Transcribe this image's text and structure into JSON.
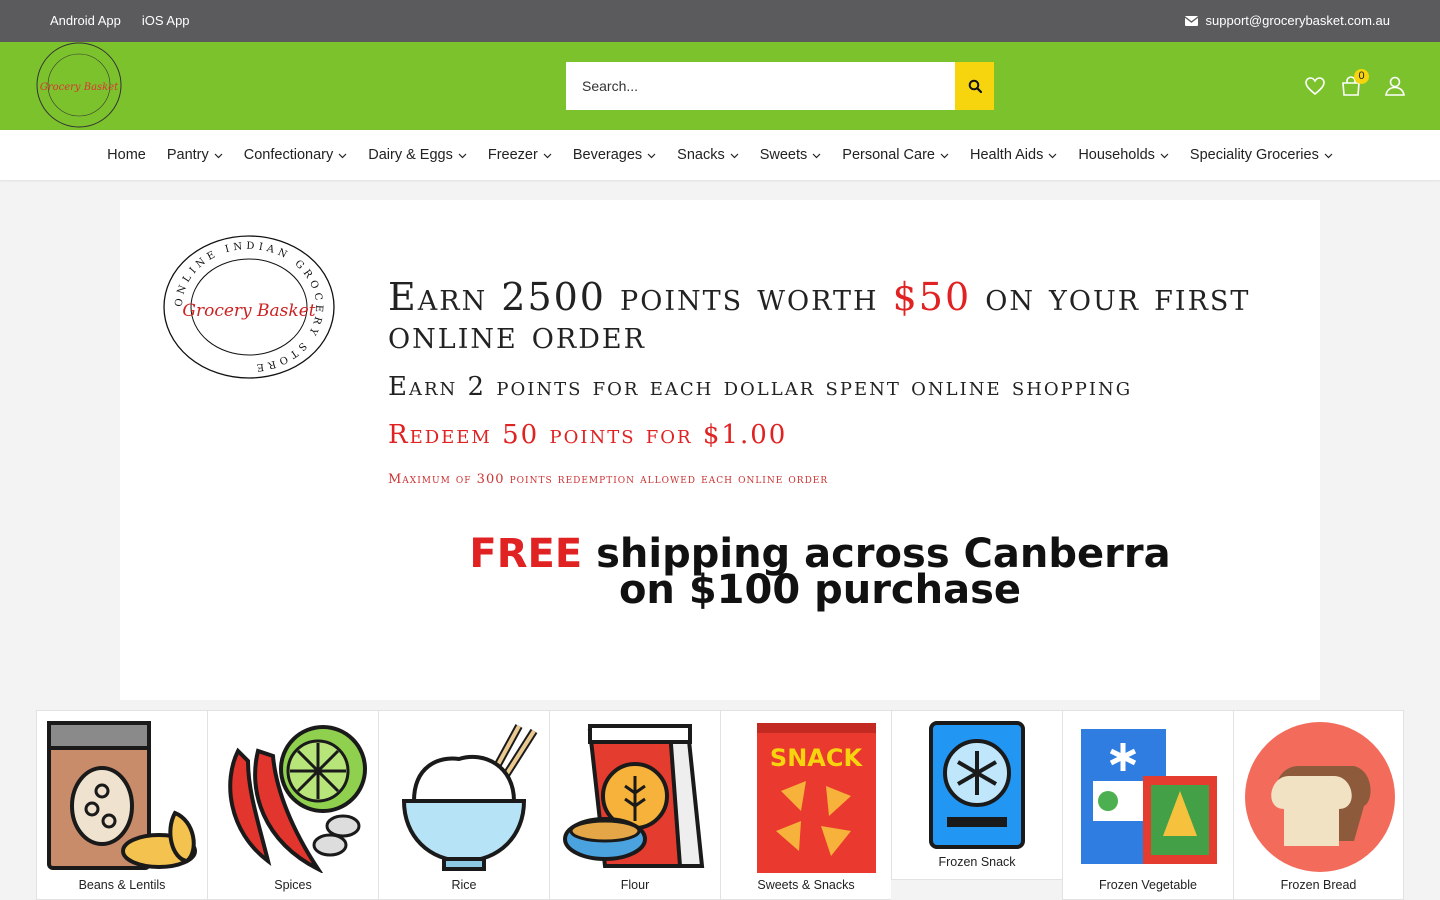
{
  "topbar": {
    "apps": [
      "Android App",
      "iOS App"
    ],
    "email": "support@grocerybasket.com.au"
  },
  "header": {
    "logo_text": "Grocery Basket",
    "search_placeholder": "Search...",
    "cart_count": "0"
  },
  "nav": {
    "items": [
      "Home",
      "Pantry",
      "Confectionary",
      "Dairy & Eggs",
      "Freezer",
      "Beverages",
      "Snacks",
      "Sweets",
      "Personal Care",
      "Health Aids",
      "Households",
      "Speciality Groceries"
    ]
  },
  "banner": {
    "logo_ring_text": "ONLINE INDIAN GROCERY STORE",
    "logo_script": "Grocery Basket",
    "line1_a": "Earn 2500 points worth ",
    "line1_red": "$50",
    "line1_b": " on your first online order",
    "line2": "Earn 2 points for each dollar spent online shopping",
    "line3": "Redeem 50 points for $1.00",
    "line4": "Maximum of 300 points redemption allowed each online order",
    "free_red": "FREE",
    "free_rest": " shipping across Canberra on $100 purchase"
  },
  "categories": [
    "Beans & Lentils",
    "Spices",
    "Rice",
    "Flour",
    "Sweets & Snacks",
    "Frozen Snack",
    "Frozen Vegetable",
    "Frozen Bread"
  ],
  "icon_texts": {
    "snack": "SNACK"
  },
  "colors": {
    "topbar": "#5b5a5c",
    "header": "#7cc22d",
    "accent": "#f7d50e",
    "red": "#e02222"
  }
}
